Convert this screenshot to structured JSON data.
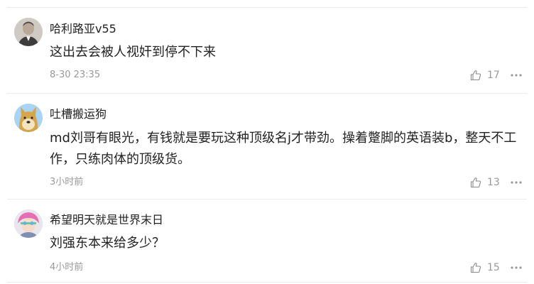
{
  "comments": [
    {
      "user": "哈利路亚v55",
      "avatar_icon": "man-avatar-icon",
      "text": "这出去会被人视奸到停不下来",
      "time": "8-30 23:35",
      "likes": "17"
    },
    {
      "user": "吐槽搬运狗",
      "avatar_icon": "doge-avatar-icon",
      "text": "md刘哥有眼光，有钱就是要玩这种顶级名j才带劲。操着蹩脚的英语装b，整天不工作，只练肉体的顶级货。",
      "time": "3小时前",
      "likes": "13"
    },
    {
      "user": "希望明天就是世界末日",
      "avatar_icon": "anime-pink-hair-avatar-icon",
      "text": "刘强东本来给多少？",
      "time": "4小时前",
      "likes": "15"
    }
  ],
  "colors": {
    "text": "#222222",
    "meta": "#999999",
    "divider": "#ececec"
  }
}
